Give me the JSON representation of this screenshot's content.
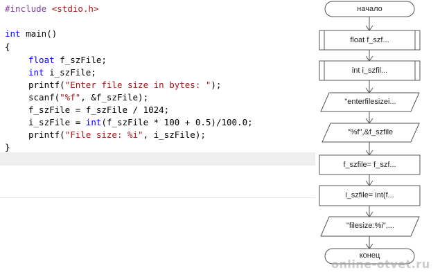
{
  "code": {
    "include_directive": "#include",
    "include_header": " <stdio.h>",
    "main_kw": "int",
    "main_sig": " main()",
    "open_brace": "{",
    "decl_float_kw": "float",
    "decl_float_rest": " f_szFile;",
    "decl_int_kw": "int",
    "decl_int_rest": " i_szFile;",
    "printf1_fn": "printf(",
    "printf1_str": "\"Enter file size in bytes: \"",
    "printf1_end": ");",
    "scanf_fn": "scanf(",
    "scanf_str": "\"%f\"",
    "scanf_end": ", &f_szFile);",
    "assign1": "f_szFile = f_szFile / 1024;",
    "assign2_a": "i_szFile = ",
    "assign2_kw": "int",
    "assign2_b": "(f_szFile * 100 + 0.5)/100.0;",
    "printf2_fn": "printf(",
    "printf2_str": "\"File size: %i\"",
    "printf2_end": ", i_szFile);",
    "close_brace": "}"
  },
  "flowchart": {
    "start": "начало",
    "decl_float": "float f_szf...",
    "decl_int": "int i_szfil...",
    "input_prompt": "\"enterfilesizei...",
    "scanf_io": "\"%f\",&f_szfile",
    "proc1": "f_szfile= f_szf...",
    "proc2": "i_szfile= int(f...",
    "print_io": "\"filesize:%i\",...",
    "end": "конец"
  },
  "watermark": "online-otvet.ru"
}
